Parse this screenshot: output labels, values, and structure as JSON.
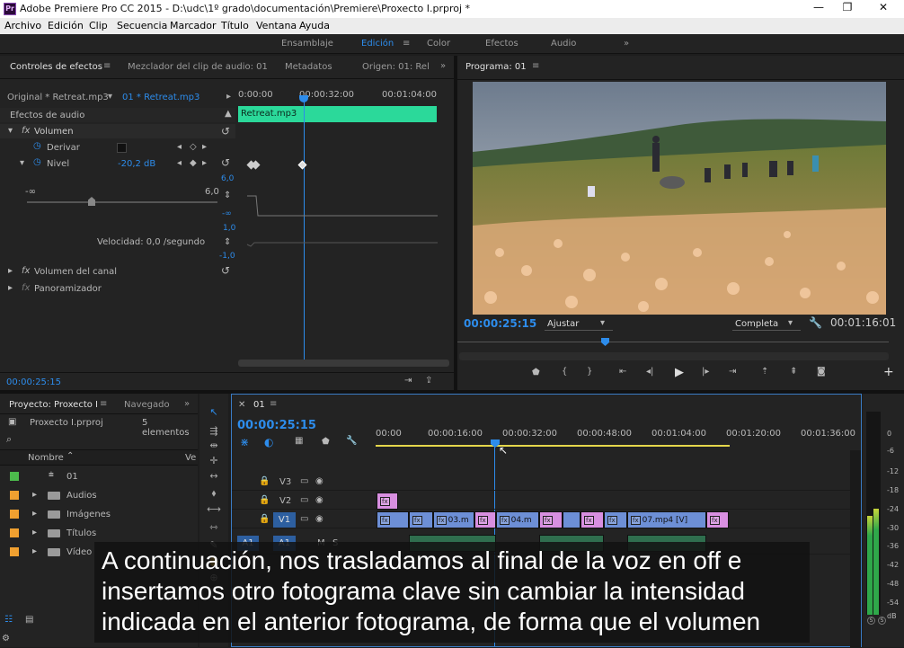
{
  "titlebar": {
    "app_icon": "Pr",
    "title": "Adobe Premiere Pro CC 2015 - D:\\udc\\1º grado\\documentación\\Premiere\\Proxecto I.prproj *",
    "minimize": "—",
    "maximize": "❐",
    "close": "✕"
  },
  "menu": [
    "Archivo",
    "Edición",
    "Clip",
    "Secuencia",
    "Marcador",
    "Título",
    "Ventana",
    "Ayuda"
  ],
  "workspaces": {
    "items": [
      "Ensamblaje",
      "Edición",
      "Color",
      "Efectos",
      "Audio"
    ],
    "active": "Edición",
    "more": "»"
  },
  "effect_controls": {
    "tabs": [
      "Controles de efectos",
      "Mezclador del clip de audio: 01",
      "Metadatos",
      "Origen: 01: Rel"
    ],
    "master": "Original * Retreat.mp3",
    "clip": "01 * Retreat.mp3",
    "ruler": [
      "0:00:00",
      "00:00:32:00",
      "00:01:04:00"
    ],
    "clip_bar": "Retreat.mp3",
    "section": "Efectos de audio",
    "volume": "Volumen",
    "bypass": "Derivar",
    "level_label": "Nivel",
    "level_value": "-20,2 dB",
    "slider_min": "-∞",
    "slider_max": "6,0",
    "graph_labels": [
      "6,0",
      "-∞",
      "1,0",
      "-1,0"
    ],
    "velocity": "Velocidad: 0,0 /segundo",
    "channel_volume": "Volumen del canal",
    "panner": "Panoramizador",
    "timecode": "00:00:25:15"
  },
  "program": {
    "tab": "Programa: 01",
    "timecode": "00:00:25:15",
    "fit": "Ajustar",
    "quality": "Completa",
    "duration": "00:01:16:01"
  },
  "project": {
    "tabs": [
      "Proyecto: Proxecto I",
      "Navegado"
    ],
    "filename": "Proxecto I.prproj",
    "count": "5 elementos",
    "col_name": "Nombre",
    "col_right": "Ve",
    "items": [
      {
        "name": "01",
        "color": "#4cba4c",
        "type": "sequence"
      },
      {
        "name": "Audios",
        "color": "#f0a030",
        "type": "folder"
      },
      {
        "name": "Imágenes",
        "color": "#f0a030",
        "type": "folder"
      },
      {
        "name": "Títulos",
        "color": "#f0a030",
        "type": "folder"
      },
      {
        "name": "Vídeo",
        "color": "#f0a030",
        "type": "folder"
      }
    ]
  },
  "timeline": {
    "tab": "01",
    "timecode": "00:00:25:15",
    "ruler": [
      "00:00",
      "00:00:16:00",
      "00:00:32:00",
      "00:00:48:00",
      "00:01:04:00",
      "00:01:20:00",
      "00:01:36:00"
    ],
    "tracks": [
      "V3",
      "V2",
      "V1",
      "A1",
      "A1"
    ],
    "clips_v1": [
      "03.m",
      "04.m",
      "07.mp4 [V]"
    ],
    "track_mute": "M",
    "track_solo": "S"
  },
  "meter": {
    "labels": [
      "0",
      "-6",
      "-12",
      "-18",
      "-24",
      "-30",
      "-36",
      "-42",
      "-48",
      "-54",
      "dB"
    ],
    "level_left": 0.58,
    "level_right": 0.62,
    "solo_left": "S",
    "solo_right": "S"
  },
  "subtitle": "A continuación, nos trasladamos al final de la voz en off e insertamos otro fotograma clave sin cambiar la intensidad indicada en el anterior fotograma, de forma que el volumen",
  "colors": {
    "accent": "#2d8ceb",
    "audio_clip": "#2bd99a",
    "video_clip": "#6d8fd6",
    "pink_clip": "#d88fe0"
  }
}
